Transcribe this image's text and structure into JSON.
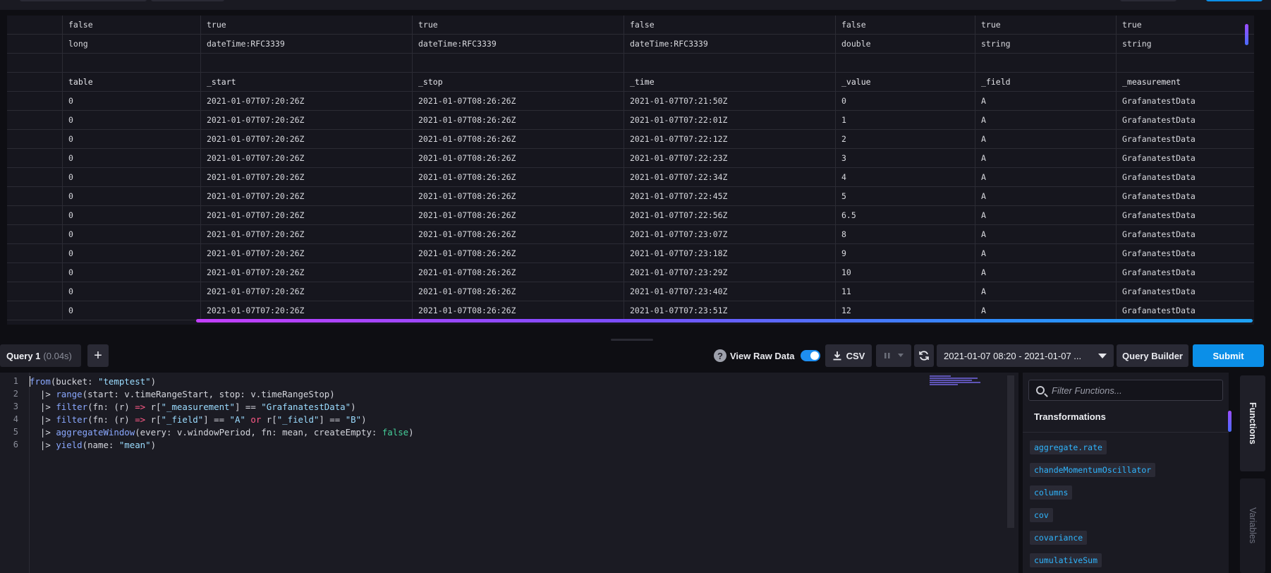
{
  "colors": {
    "accent": "#0b8fe8",
    "background": "#0e0e13",
    "function_text": "#2fb6ff"
  },
  "raw_table": {
    "meta_rows": [
      [
        "",
        "false",
        "true",
        "true",
        "false",
        "false",
        "true",
        "true"
      ],
      [
        "",
        "long",
        "dateTime:RFC3339",
        "dateTime:RFC3339",
        "dateTime:RFC3339",
        "double",
        "string",
        "string"
      ],
      [
        "",
        "",
        "",
        "",
        "",
        "",
        "",
        ""
      ]
    ],
    "header": [
      "",
      "table",
      "_start",
      "_stop",
      "_time",
      "_value",
      "_field",
      "_measurement"
    ],
    "rows": [
      [
        "",
        "0",
        "2021-01-07T07:20:26Z",
        "2021-01-07T08:26:26Z",
        "2021-01-07T07:21:50Z",
        "0",
        "A",
        "GrafanatestData"
      ],
      [
        "",
        "0",
        "2021-01-07T07:20:26Z",
        "2021-01-07T08:26:26Z",
        "2021-01-07T07:22:01Z",
        "1",
        "A",
        "GrafanatestData"
      ],
      [
        "",
        "0",
        "2021-01-07T07:20:26Z",
        "2021-01-07T08:26:26Z",
        "2021-01-07T07:22:12Z",
        "2",
        "A",
        "GrafanatestData"
      ],
      [
        "",
        "0",
        "2021-01-07T07:20:26Z",
        "2021-01-07T08:26:26Z",
        "2021-01-07T07:22:23Z",
        "3",
        "A",
        "GrafanatestData"
      ],
      [
        "",
        "0",
        "2021-01-07T07:20:26Z",
        "2021-01-07T08:26:26Z",
        "2021-01-07T07:22:34Z",
        "4",
        "A",
        "GrafanatestData"
      ],
      [
        "",
        "0",
        "2021-01-07T07:20:26Z",
        "2021-01-07T08:26:26Z",
        "2021-01-07T07:22:45Z",
        "5",
        "A",
        "GrafanatestData"
      ],
      [
        "",
        "0",
        "2021-01-07T07:20:26Z",
        "2021-01-07T08:26:26Z",
        "2021-01-07T07:22:56Z",
        "6.5",
        "A",
        "GrafanatestData"
      ],
      [
        "",
        "0",
        "2021-01-07T07:20:26Z",
        "2021-01-07T08:26:26Z",
        "2021-01-07T07:23:07Z",
        "8",
        "A",
        "GrafanatestData"
      ],
      [
        "",
        "0",
        "2021-01-07T07:20:26Z",
        "2021-01-07T08:26:26Z",
        "2021-01-07T07:23:18Z",
        "9",
        "A",
        "GrafanatestData"
      ],
      [
        "",
        "0",
        "2021-01-07T07:20:26Z",
        "2021-01-07T08:26:26Z",
        "2021-01-07T07:23:29Z",
        "10",
        "A",
        "GrafanatestData"
      ],
      [
        "",
        "0",
        "2021-01-07T07:20:26Z",
        "2021-01-07T08:26:26Z",
        "2021-01-07T07:23:40Z",
        "11",
        "A",
        "GrafanatestData"
      ],
      [
        "",
        "0",
        "2021-01-07T07:20:26Z",
        "2021-01-07T08:26:26Z",
        "2021-01-07T07:23:51Z",
        "12",
        "A",
        "GrafanatestData"
      ]
    ]
  },
  "query_toolbar": {
    "tab_label": "Query 1",
    "tab_time": "(0.04s)",
    "add_label": "+",
    "help_glyph": "?",
    "view_raw_label": "View Raw Data",
    "view_raw_on": true,
    "csv_label": "CSV",
    "time_range": "2021-01-07 08:20 - 2021-01-07 ...",
    "query_builder_label": "Query Builder",
    "submit_label": "Submit"
  },
  "editor": {
    "line_numbers": [
      "1",
      "2",
      "3",
      "4",
      "5",
      "6"
    ]
  },
  "functions_panel": {
    "search_placeholder": "Filter Functions...",
    "section_title": "Transformations",
    "items": [
      "aggregate.rate",
      "chandeMomentumOscillator",
      "columns",
      "cov",
      "covariance",
      "cumulativeSum"
    ]
  },
  "side_tabs": {
    "functions": "Functions",
    "variables": "Variables"
  }
}
